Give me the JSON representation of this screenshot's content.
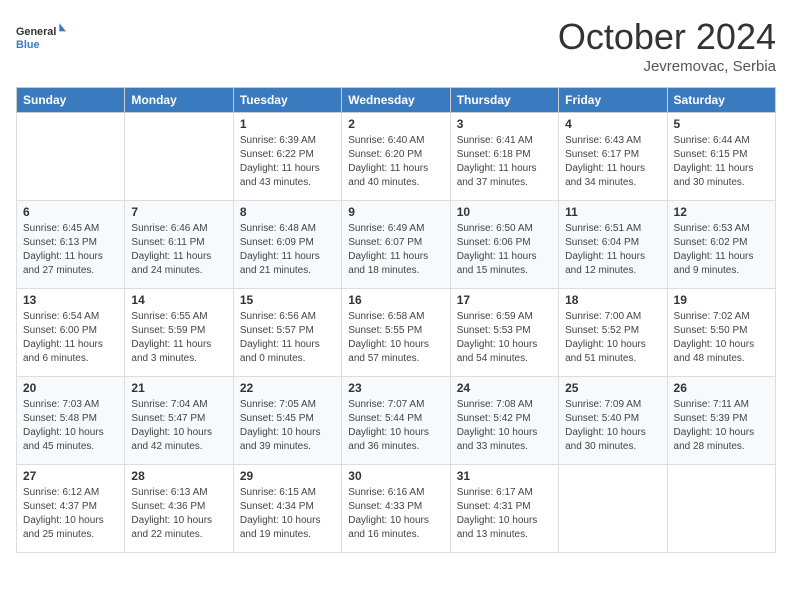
{
  "header": {
    "logo_general": "General",
    "logo_blue": "Blue",
    "month_title": "October 2024",
    "location": "Jevremovac, Serbia"
  },
  "weekdays": [
    "Sunday",
    "Monday",
    "Tuesday",
    "Wednesday",
    "Thursday",
    "Friday",
    "Saturday"
  ],
  "weeks": [
    [
      {
        "day": "",
        "content": ""
      },
      {
        "day": "",
        "content": ""
      },
      {
        "day": "1",
        "content": "Sunrise: 6:39 AM\nSunset: 6:22 PM\nDaylight: 11 hours and 43 minutes."
      },
      {
        "day": "2",
        "content": "Sunrise: 6:40 AM\nSunset: 6:20 PM\nDaylight: 11 hours and 40 minutes."
      },
      {
        "day": "3",
        "content": "Sunrise: 6:41 AM\nSunset: 6:18 PM\nDaylight: 11 hours and 37 minutes."
      },
      {
        "day": "4",
        "content": "Sunrise: 6:43 AM\nSunset: 6:17 PM\nDaylight: 11 hours and 34 minutes."
      },
      {
        "day": "5",
        "content": "Sunrise: 6:44 AM\nSunset: 6:15 PM\nDaylight: 11 hours and 30 minutes."
      }
    ],
    [
      {
        "day": "6",
        "content": "Sunrise: 6:45 AM\nSunset: 6:13 PM\nDaylight: 11 hours and 27 minutes."
      },
      {
        "day": "7",
        "content": "Sunrise: 6:46 AM\nSunset: 6:11 PM\nDaylight: 11 hours and 24 minutes."
      },
      {
        "day": "8",
        "content": "Sunrise: 6:48 AM\nSunset: 6:09 PM\nDaylight: 11 hours and 21 minutes."
      },
      {
        "day": "9",
        "content": "Sunrise: 6:49 AM\nSunset: 6:07 PM\nDaylight: 11 hours and 18 minutes."
      },
      {
        "day": "10",
        "content": "Sunrise: 6:50 AM\nSunset: 6:06 PM\nDaylight: 11 hours and 15 minutes."
      },
      {
        "day": "11",
        "content": "Sunrise: 6:51 AM\nSunset: 6:04 PM\nDaylight: 11 hours and 12 minutes."
      },
      {
        "day": "12",
        "content": "Sunrise: 6:53 AM\nSunset: 6:02 PM\nDaylight: 11 hours and 9 minutes."
      }
    ],
    [
      {
        "day": "13",
        "content": "Sunrise: 6:54 AM\nSunset: 6:00 PM\nDaylight: 11 hours and 6 minutes."
      },
      {
        "day": "14",
        "content": "Sunrise: 6:55 AM\nSunset: 5:59 PM\nDaylight: 11 hours and 3 minutes."
      },
      {
        "day": "15",
        "content": "Sunrise: 6:56 AM\nSunset: 5:57 PM\nDaylight: 11 hours and 0 minutes."
      },
      {
        "day": "16",
        "content": "Sunrise: 6:58 AM\nSunset: 5:55 PM\nDaylight: 10 hours and 57 minutes."
      },
      {
        "day": "17",
        "content": "Sunrise: 6:59 AM\nSunset: 5:53 PM\nDaylight: 10 hours and 54 minutes."
      },
      {
        "day": "18",
        "content": "Sunrise: 7:00 AM\nSunset: 5:52 PM\nDaylight: 10 hours and 51 minutes."
      },
      {
        "day": "19",
        "content": "Sunrise: 7:02 AM\nSunset: 5:50 PM\nDaylight: 10 hours and 48 minutes."
      }
    ],
    [
      {
        "day": "20",
        "content": "Sunrise: 7:03 AM\nSunset: 5:48 PM\nDaylight: 10 hours and 45 minutes."
      },
      {
        "day": "21",
        "content": "Sunrise: 7:04 AM\nSunset: 5:47 PM\nDaylight: 10 hours and 42 minutes."
      },
      {
        "day": "22",
        "content": "Sunrise: 7:05 AM\nSunset: 5:45 PM\nDaylight: 10 hours and 39 minutes."
      },
      {
        "day": "23",
        "content": "Sunrise: 7:07 AM\nSunset: 5:44 PM\nDaylight: 10 hours and 36 minutes."
      },
      {
        "day": "24",
        "content": "Sunrise: 7:08 AM\nSunset: 5:42 PM\nDaylight: 10 hours and 33 minutes."
      },
      {
        "day": "25",
        "content": "Sunrise: 7:09 AM\nSunset: 5:40 PM\nDaylight: 10 hours and 30 minutes."
      },
      {
        "day": "26",
        "content": "Sunrise: 7:11 AM\nSunset: 5:39 PM\nDaylight: 10 hours and 28 minutes."
      }
    ],
    [
      {
        "day": "27",
        "content": "Sunrise: 6:12 AM\nSunset: 4:37 PM\nDaylight: 10 hours and 25 minutes."
      },
      {
        "day": "28",
        "content": "Sunrise: 6:13 AM\nSunset: 4:36 PM\nDaylight: 10 hours and 22 minutes."
      },
      {
        "day": "29",
        "content": "Sunrise: 6:15 AM\nSunset: 4:34 PM\nDaylight: 10 hours and 19 minutes."
      },
      {
        "day": "30",
        "content": "Sunrise: 6:16 AM\nSunset: 4:33 PM\nDaylight: 10 hours and 16 minutes."
      },
      {
        "day": "31",
        "content": "Sunrise: 6:17 AM\nSunset: 4:31 PM\nDaylight: 10 hours and 13 minutes."
      },
      {
        "day": "",
        "content": ""
      },
      {
        "day": "",
        "content": ""
      }
    ]
  ]
}
